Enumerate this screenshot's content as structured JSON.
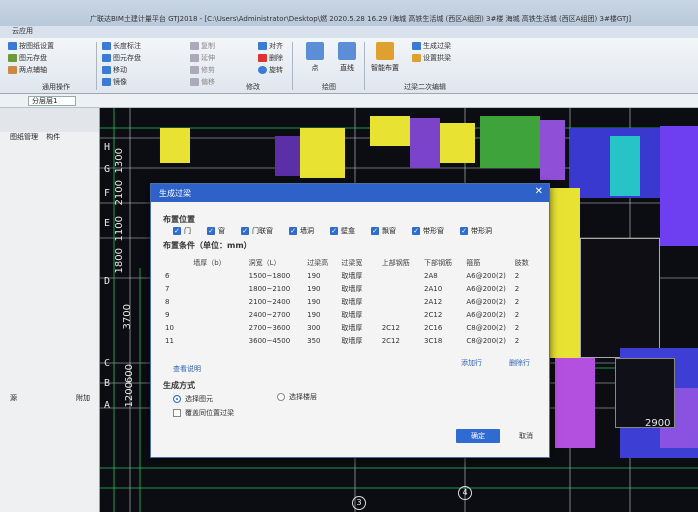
{
  "window": {
    "title": "广联达BIM土建计量平台 GTJ2018 - [C:\\Users\\Administrator\\Desktop\\燃 2020.5.28 16.29 (海城 高铁生活城 (西区A组团) 3#楼 海城 高铁生活城 (西区A组团) 3#楼GTJ]",
    "menu_tabs": [
      "",
      "云应用"
    ]
  },
  "ribbon": {
    "common_group": [
      "按图纸设置",
      "图元存盘",
      "两点辅轴"
    ],
    "common_label": "通用操作",
    "edit_col1": [
      "长度标注",
      "图元存盘",
      "移动",
      "镜像"
    ],
    "edit_col2": [
      "复制",
      "延伸",
      "修剪",
      "偏移"
    ],
    "edit_col3": [
      "对齐",
      "删除",
      "旋转"
    ],
    "edit_label": "修改",
    "draw_items": [
      "点",
      "直线"
    ],
    "draw_label": "绘图",
    "smart_btn": "智能布置",
    "lintel_btn": "设置拱梁",
    "gen_btn": "生成过梁",
    "lintel_group_label": "过梁二次编辑"
  },
  "subbar": {
    "floor_select": "分层层1"
  },
  "leftpanel": {
    "header": [
      "图纸管理",
      "构件"
    ],
    "footer_left": "源",
    "footer_right": "附加"
  },
  "canvas": {
    "axis_letters": [
      "H",
      "G",
      "F",
      "E",
      "D",
      "C",
      "B",
      "A"
    ],
    "dims_left": [
      "1300",
      "2100",
      "1100",
      "1800"
    ],
    "dims_lower": [
      "3700",
      "600",
      "1200"
    ],
    "bottom_axis": [
      "3",
      "4"
    ],
    "dim_2900": "2900"
  },
  "dialog": {
    "title": "生成过梁",
    "position_section": "布置位置",
    "positions": [
      {
        "label": "门",
        "checked": true
      },
      {
        "label": "窗",
        "checked": true
      },
      {
        "label": "门联窗",
        "checked": true
      },
      {
        "label": "墙洞",
        "checked": true
      },
      {
        "label": "壁龛",
        "checked": true
      },
      {
        "label": "飘窗",
        "checked": true
      },
      {
        "label": "带形窗",
        "checked": true
      },
      {
        "label": "带形洞",
        "checked": true
      }
    ],
    "condition_section": "布置条件（单位：mm）",
    "columns": [
      "墙厚（b）",
      "洞宽（L）",
      "过梁高",
      "过梁宽",
      "上部钢筋",
      "下部钢筋",
      "箍筋",
      "肢数"
    ],
    "rows": [
      [
        "6",
        "1500~1800",
        "190",
        "取墙厚",
        "",
        "2A8",
        "A6@200(2)",
        "2"
      ],
      [
        "7",
        "1800~2100",
        "190",
        "取墙厚",
        "",
        "2A10",
        "A6@200(2)",
        "2"
      ],
      [
        "8",
        "2100~2400",
        "190",
        "取墙厚",
        "",
        "2A12",
        "A6@200(2)",
        "2"
      ],
      [
        "9",
        "2400~2700",
        "190",
        "取墙厚",
        "",
        "2C12",
        "A6@200(2)",
        "2"
      ],
      [
        "10",
        "2700~3600",
        "300",
        "取墙厚",
        "2C12",
        "2C16",
        "C8@200(2)",
        "2"
      ],
      [
        "11",
        "3600~4500",
        "350",
        "取墙厚",
        "2C12",
        "3C18",
        "C8@200(2)",
        "2"
      ]
    ],
    "view_note": "查看说明",
    "add_row": "添加行",
    "delete_row": "删除行",
    "method_section": "生成方式",
    "method_options": [
      "选择图元",
      "选择楼层"
    ],
    "overwrite_label": "覆盖同位置过梁",
    "ok": "确定",
    "cancel": "取消"
  },
  "colors": {
    "dialog_title_bg": "#2e62c9",
    "checkbox_blue": "#2f6bd1",
    "cad_bg": "#0c0d12"
  }
}
